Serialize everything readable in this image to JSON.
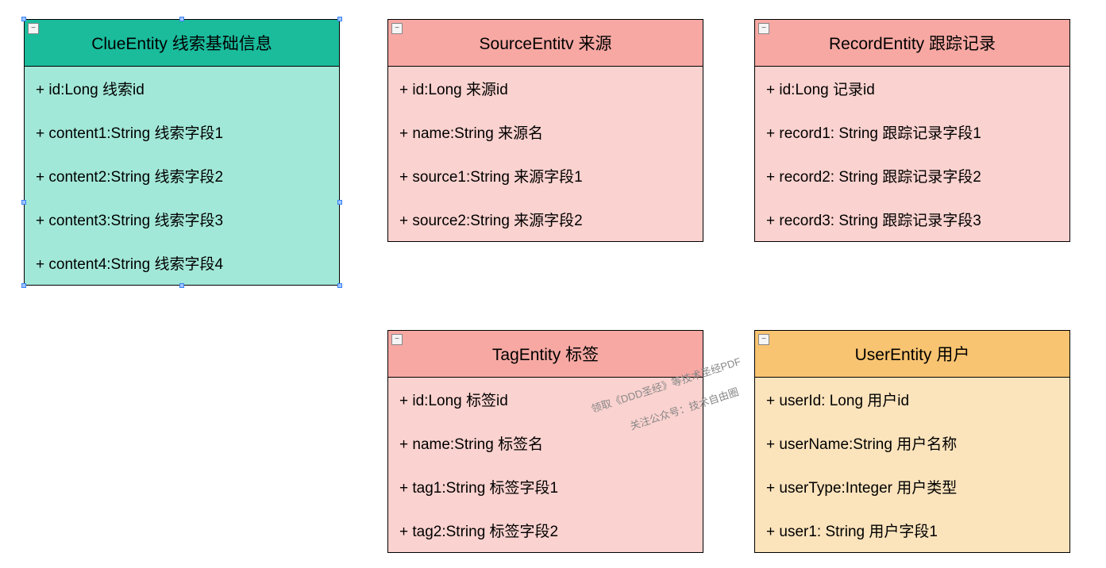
{
  "entities": {
    "clue": {
      "title": "ClueEntity 线索基础信息",
      "attrs": [
        "+ id:Long 线索id",
        "+ content1:String 线索字段1",
        "+ content2:String 线索字段2",
        "+ content3:String 线索字段3",
        "+ content4:String 线索字段4"
      ]
    },
    "source": {
      "title": "SourceEntitv 来源",
      "attrs": [
        "+ id:Long 来源id",
        "+ name:String 来源名",
        "+ source1:String 来源字段1",
        "+ source2:String 来源字段2"
      ]
    },
    "record": {
      "title": "RecordEntity 跟踪记录",
      "attrs": [
        "+ id:Long 记录id",
        "+ record1: String 跟踪记录字段1",
        "+ record2: String 跟踪记录字段2",
        "+ record3: String 跟踪记录字段3"
      ]
    },
    "tag": {
      "title": "TagEntity 标签",
      "attrs": [
        "+ id:Long 标签id",
        "+ name:String 标签名",
        "+ tag1:String 标签字段1",
        "+ tag2:String 标签字段2"
      ]
    },
    "user": {
      "title": "UserEntity 用户",
      "attrs": [
        "+ userId: Long 用户id",
        "+ userName:String 用户名称",
        "+ userType:Integer 用户类型",
        "+ user1: String 用户字段1"
      ]
    }
  },
  "watermark": {
    "line1": "领取《DDD圣经》等技术圣经PDF",
    "line2": "关注公众号：技术自由圈"
  },
  "collapse_glyph": "−"
}
